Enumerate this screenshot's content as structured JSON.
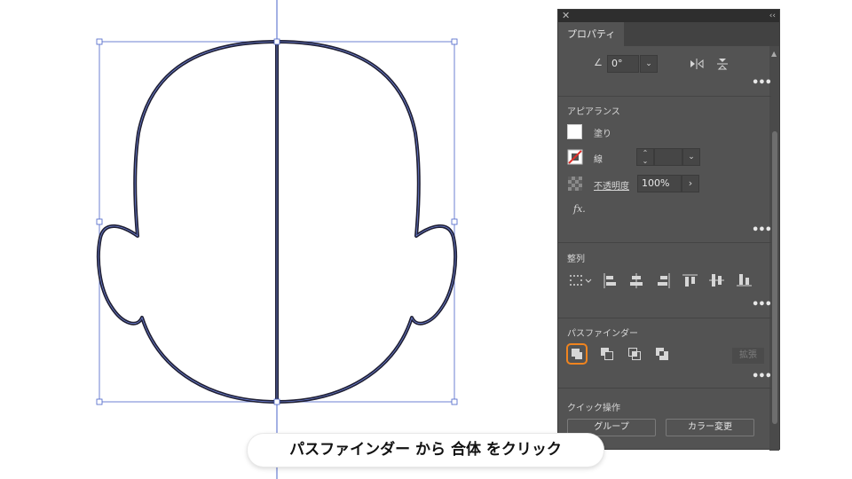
{
  "panel": {
    "tab_label": "プロパティ",
    "transform": {
      "rotate_value": "0°"
    },
    "appearance": {
      "title": "アピアランス",
      "fill_label": "塗り",
      "stroke_label": "線",
      "opacity_label": "不透明度",
      "opacity_value": "100%",
      "fx_label": "fx."
    },
    "align": {
      "title": "整列"
    },
    "pathfinder": {
      "title": "パスファインダー",
      "expand_label": "拡張"
    },
    "quick_actions": {
      "title": "クイック操作",
      "group_label": "グループ",
      "recolor_label": "カラー変更"
    },
    "more_label": "•••"
  },
  "caption": {
    "text": "パスファインダー から 合体 をクリック"
  },
  "colors": {
    "accent": "#f0841f",
    "selection": "#4a63c8",
    "panel": "#535353"
  }
}
